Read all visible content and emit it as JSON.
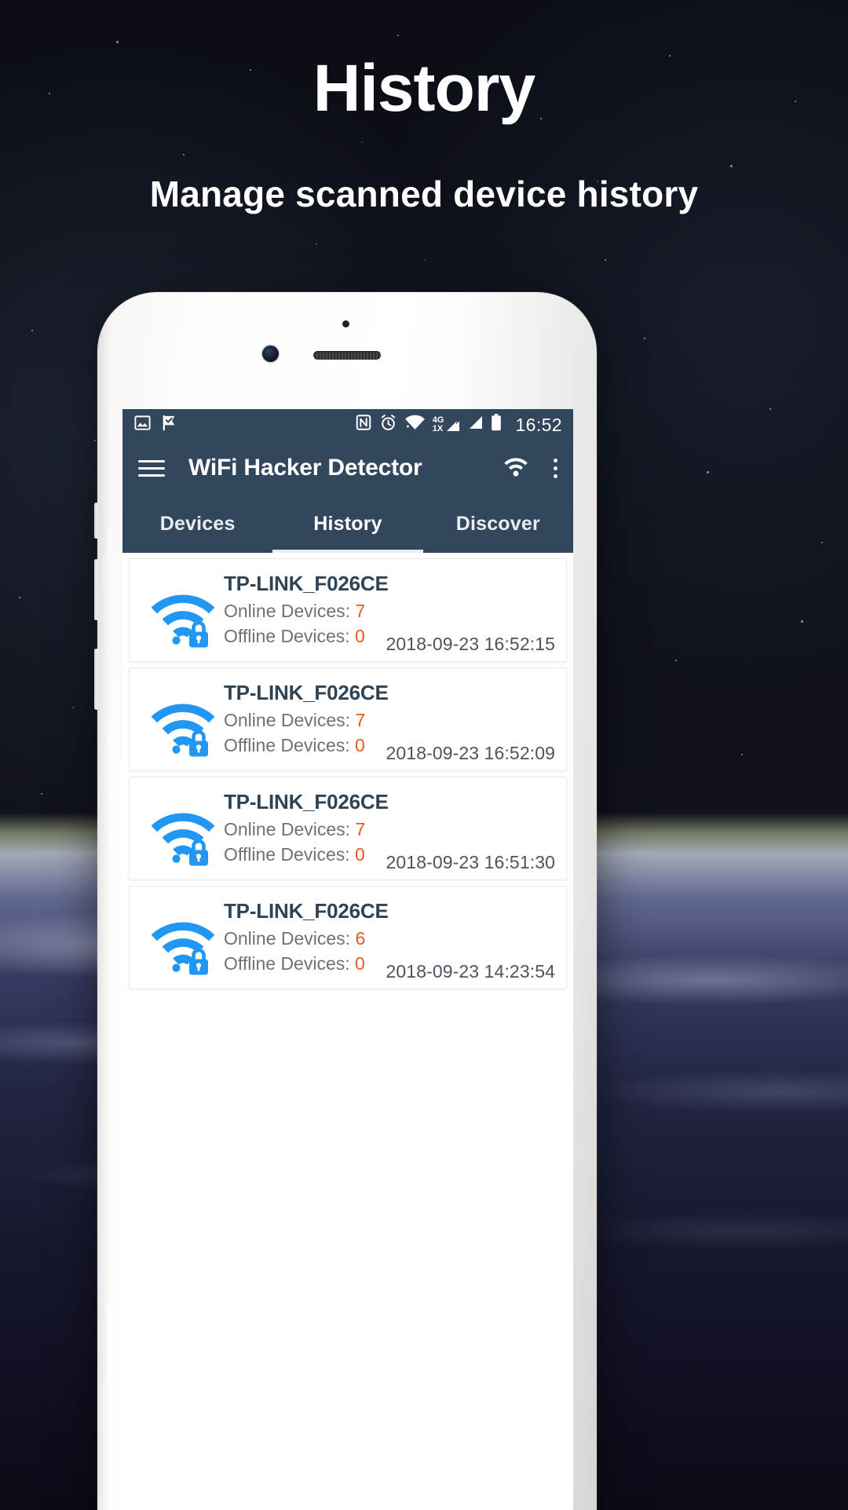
{
  "promo": {
    "title": "History",
    "subtitle": "Manage scanned device history"
  },
  "colors": {
    "toolbar": "#32465c",
    "accent_blue": "#2196f3",
    "accent_orange": "#e8591f",
    "ssid_text": "#2f4355",
    "muted_text": "#6e7275",
    "card_bg": "#ffffff",
    "page_bg": "#0d1018"
  },
  "statusbar": {
    "time": "16:52",
    "left_icons": [
      "image-icon",
      "tick-flag-icon"
    ],
    "right_icons": [
      "nfc-icon",
      "alarm-icon",
      "wifi-icon",
      "signal-4g-icon",
      "signal-1x-icon",
      "battery-icon"
    ],
    "network_4g": "4G",
    "network_1x": "1X"
  },
  "toolbar": {
    "menu_icon": "hamburger-menu-icon",
    "title": "WiFi Hacker Detector",
    "wifi_icon": "wifi-icon",
    "overflow_icon": "kebab-menu-icon"
  },
  "tabs": [
    {
      "label": "Devices",
      "active": false
    },
    {
      "label": "History",
      "active": true
    },
    {
      "label": "Discover",
      "active": false
    }
  ],
  "history": [
    {
      "ssid": "TP-LINK_F026CE",
      "online_label": "Online Devices: ",
      "online_value": "7",
      "offline_label": "Offline Devices: ",
      "offline_value": "0",
      "timestamp": "2018-09-23 16:52:15",
      "icon": "wifi-lock-icon"
    },
    {
      "ssid": "TP-LINK_F026CE",
      "online_label": "Online Devices: ",
      "online_value": "7",
      "offline_label": "Offline Devices: ",
      "offline_value": "0",
      "timestamp": "2018-09-23 16:52:09",
      "icon": "wifi-lock-icon"
    },
    {
      "ssid": "TP-LINK_F026CE",
      "online_label": "Online Devices: ",
      "online_value": "7",
      "offline_label": "Offline Devices: ",
      "offline_value": "0",
      "timestamp": "2018-09-23 16:51:30",
      "icon": "wifi-lock-icon"
    },
    {
      "ssid": "TP-LINK_F026CE",
      "online_label": "Online Devices: ",
      "online_value": "6",
      "offline_label": "Offline Devices: ",
      "offline_value": "0",
      "timestamp": "2018-09-23 14:23:54",
      "icon": "wifi-lock-icon"
    }
  ]
}
